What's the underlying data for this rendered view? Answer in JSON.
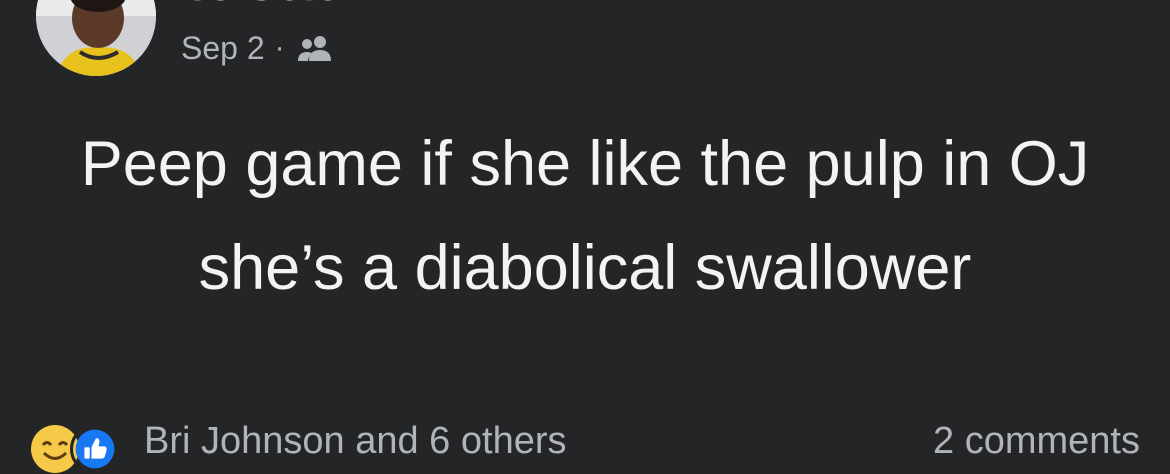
{
  "post": {
    "author_name": "Te Cole",
    "date": "Sep 2",
    "separator": "·",
    "audience_icon": "friends-icon",
    "text": "Peep game if she like the pulp in OJ she’s a diabolical swallower"
  },
  "footer": {
    "reaction_icons": [
      "smile-reaction-icon",
      "like-reaction-icon"
    ],
    "reactors": "Bri Johnson and 6 others",
    "comments": "2 comments"
  },
  "colors": {
    "background": "#242526",
    "primary_text": "#e4e6eb",
    "secondary_text": "#b0b3b8",
    "like_blue": "#1877f2",
    "emoji_yellow": "#f7c948"
  }
}
